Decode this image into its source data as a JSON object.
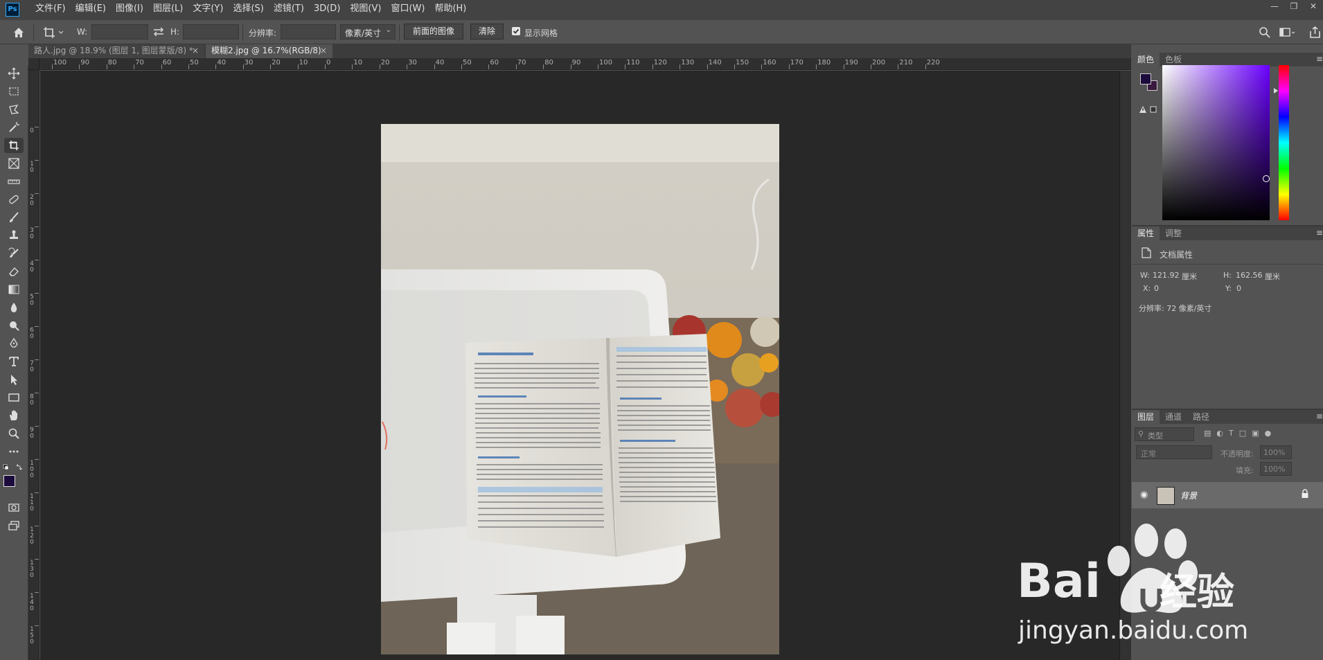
{
  "app": {
    "logo": "Ps"
  },
  "menu": [
    "文件(F)",
    "编辑(E)",
    "图像(I)",
    "图层(L)",
    "文字(Y)",
    "选择(S)",
    "滤镜(T)",
    "3D(D)",
    "视图(V)",
    "窗口(W)",
    "帮助(H)"
  ],
  "options": {
    "w_label": "W:",
    "h_label": "H:",
    "resolution_label": "分辨率:",
    "unit_select": "像素/英寸",
    "front_image_button": "前面的图像",
    "clear_button": "清除",
    "show_grid_label": "显示网格",
    "show_grid_checked": true
  },
  "doc_tabs": [
    {
      "label": "路人.jpg @ 18.9% (图层 1, 图层蒙版/8) *",
      "active": false
    },
    {
      "label": "模糊2.jpg @ 16.7%(RGB/8)",
      "active": true
    }
  ],
  "ruler_h_labels": [
    "100",
    "90",
    "80",
    "70",
    "60",
    "50",
    "40",
    "30",
    "20",
    "10",
    "0",
    "10",
    "20",
    "30",
    "40",
    "50",
    "60",
    "70",
    "80",
    "90",
    "100",
    "110",
    "120",
    "130",
    "140",
    "150",
    "160",
    "170",
    "180",
    "190",
    "200",
    "210",
    "220"
  ],
  "ruler_v_labels": [
    "0",
    "1 0",
    "2 0",
    "3 0",
    "4 0",
    "5 0",
    "6 0",
    "7 0",
    "8 0",
    "9 0",
    "1 0 0",
    "1 1 0",
    "1 2 0",
    "1 3 0",
    "1 4 0",
    "1 5 0",
    "1 6 0"
  ],
  "color_panel": {
    "tabs": [
      "颜色",
      "色板"
    ],
    "fg_color": "#1c0b3d",
    "bg_color": "#3a1a3e",
    "hue_color": "#6a00ff"
  },
  "properties_panel": {
    "tabs": [
      "属性",
      "调整"
    ],
    "title": "文档属性",
    "w_label": "W:",
    "w_value": "121.92",
    "w_unit": "厘米",
    "h_label": "H:",
    "h_value": "162.56",
    "h_unit": "厘米",
    "x_label": "X:",
    "x_value": "0",
    "y_label": "Y:",
    "y_value": "0",
    "resolution": "分辨率: 72 像素/英寸"
  },
  "layers_panel": {
    "tabs": [
      "图层",
      "通道",
      "路径"
    ],
    "filter_label": "类型",
    "blend_mode": "正常",
    "opacity_label": "不透明度:",
    "opacity_value": "100%",
    "fill_label": "填充:",
    "fill_value": "100%",
    "layers": [
      {
        "name": "背景",
        "locked": true
      }
    ]
  },
  "watermark": {
    "brand": "Bai",
    "product": "经验",
    "url": "jingyan.baidu.com"
  },
  "photo_book": {
    "heading1": "第一章 物流概述",
    "heading2": "二、物流学科的性质",
    "heading3": "三、物流学的研究对象"
  }
}
